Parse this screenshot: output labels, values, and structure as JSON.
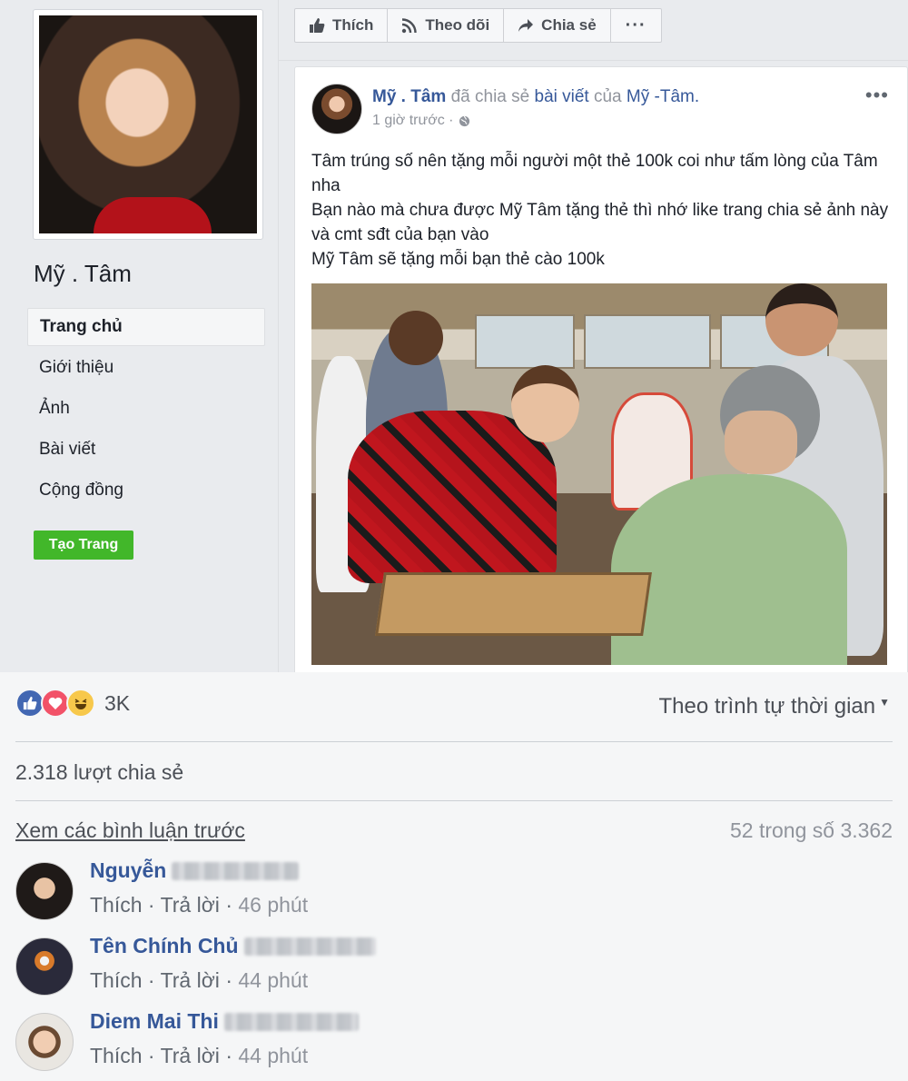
{
  "sidebar": {
    "page_name": "Mỹ . Tâm",
    "nav": [
      "Trang chủ",
      "Giới thiệu",
      "Ảnh",
      "Bài viết",
      "Cộng đồng"
    ],
    "create_page": "Tạo Trang"
  },
  "actions": {
    "like": "Thích",
    "follow": "Theo dõi",
    "share": "Chia sẻ",
    "more": "···"
  },
  "post": {
    "author": "Mỹ . Tâm",
    "shared_text": "đã chia sẻ",
    "post_word": "bài viết",
    "of_word": "của",
    "original_author": "Mỹ -Tâm.",
    "time": "1 giờ trước ·",
    "menu": "•••",
    "lines": [
      "Tâm trúng số nên tặng mỗi người một thẻ 100k coi như tấm lòng của Tâm nha",
      "Bạn nào mà chưa được Mỹ Tâm tặng thẻ thì nhớ like trang chia sẻ ảnh này và cmt sđt của bạn vào",
      "Mỹ Tâm sẽ tặng mỗi bạn thẻ cào 100k"
    ]
  },
  "reactions": {
    "count": "3K",
    "sort_label": "Theo trình tự thời gian",
    "shares": "2.318 lượt chia sẻ",
    "prev_comments": "Xem các bình luận trước",
    "comment_count": "52 trong số 3.362"
  },
  "comments": [
    {
      "name": "Nguyễn",
      "like": "Thích",
      "reply": "Trả lời",
      "sep": "·",
      "time": "46 phút"
    },
    {
      "name": "Tên Chính Chủ",
      "like": "Thích",
      "reply": "Trả lời",
      "sep": "·",
      "time": "44 phút"
    },
    {
      "name": "Diem Mai Thi",
      "like": "Thích",
      "reply": "Trả lời",
      "sep": "·",
      "time": "44 phút"
    }
  ],
  "colors": {
    "link": "#365899",
    "green_button": "#42b72a",
    "like_blue": "#4267b2",
    "love_red": "#f25268",
    "haha_yellow": "#f7c84b"
  }
}
